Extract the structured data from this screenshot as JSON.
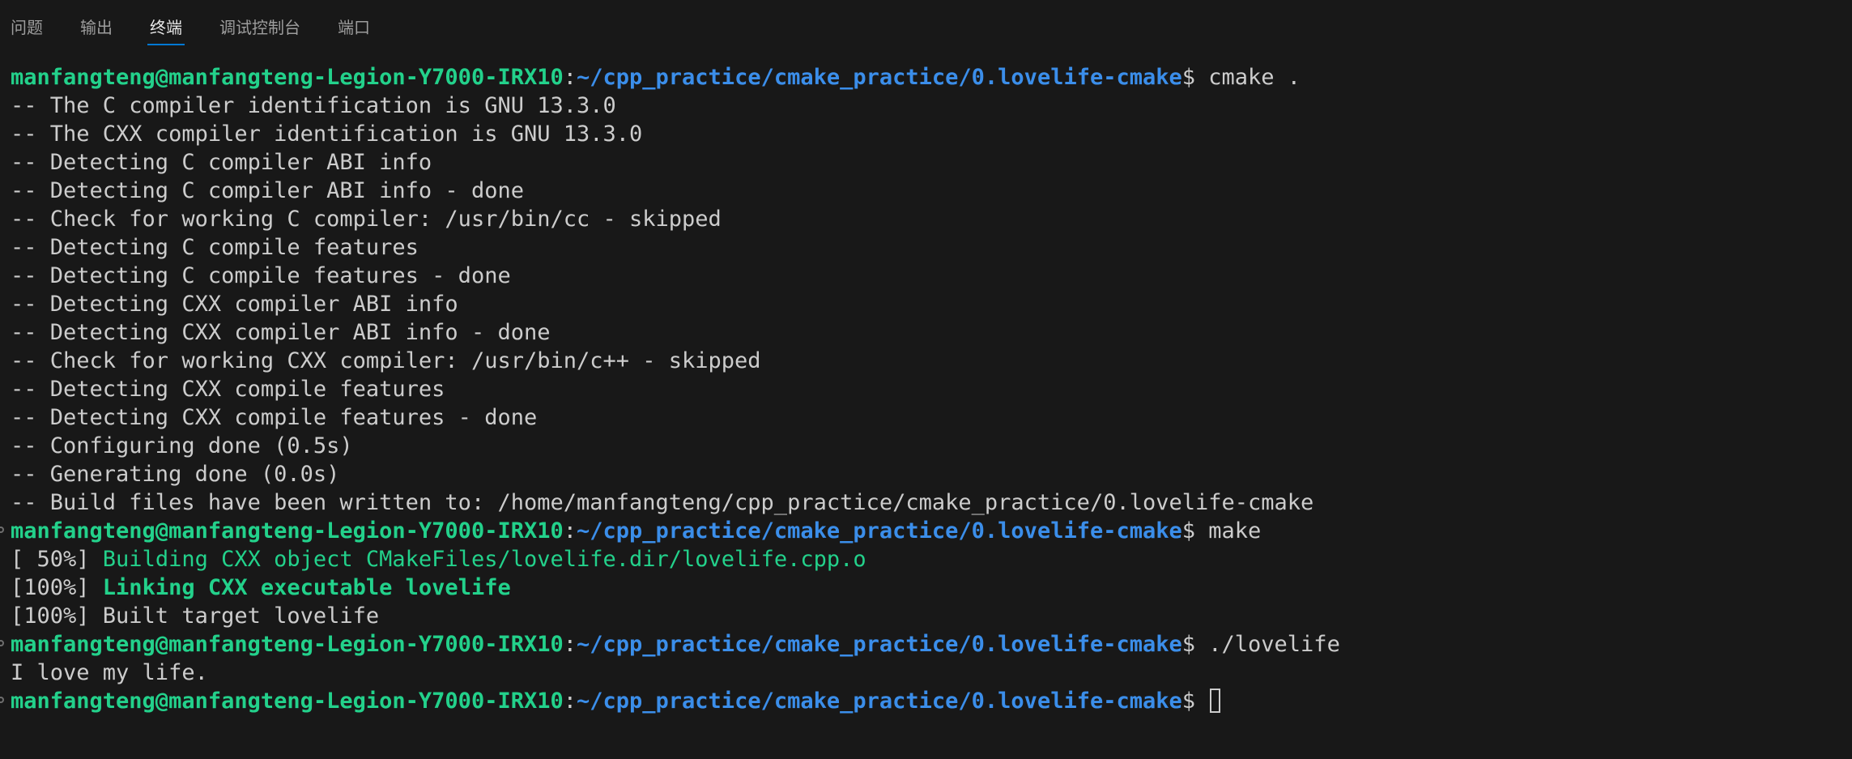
{
  "panel_tabs": [
    {
      "label": "问题",
      "active": false
    },
    {
      "label": "输出",
      "active": false
    },
    {
      "label": "终端",
      "active": true
    },
    {
      "label": "调试控制台",
      "active": false
    },
    {
      "label": "端口",
      "active": false
    }
  ],
  "prompt": {
    "user_host": "manfangteng@manfangteng-Legion-Y7000-IRX10",
    "separator": ":",
    "path": "~/cpp_practice/cmake_practice/0.lovelife-cmake",
    "symbol": "$ "
  },
  "commands": {
    "cmake": "cmake .",
    "make": "make",
    "run": "./lovelife"
  },
  "cmake_output": [
    "-- The C compiler identification is GNU 13.3.0",
    "-- The CXX compiler identification is GNU 13.3.0",
    "-- Detecting C compiler ABI info",
    "-- Detecting C compiler ABI info - done",
    "-- Check for working C compiler: /usr/bin/cc - skipped",
    "-- Detecting C compile features",
    "-- Detecting C compile features - done",
    "-- Detecting CXX compiler ABI info",
    "-- Detecting CXX compiler ABI info - done",
    "-- Check for working CXX compiler: /usr/bin/c++ - skipped",
    "-- Detecting CXX compile features",
    "-- Detecting CXX compile features - done",
    "-- Configuring done (0.5s)",
    "-- Generating done (0.0s)",
    "-- Build files have been written to: /home/manfangteng/cpp_practice/cmake_practice/0.lovelife-cmake"
  ],
  "make_output": {
    "line1_progress": "[ 50%] ",
    "line1_text": "Building CXX object CMakeFiles/lovelife.dir/lovelife.cpp.o",
    "line2_progress": "[100%] ",
    "line2_text": "Linking CXX executable lovelife",
    "line3": "[100%] Built target lovelife"
  },
  "run_output": "I love my life.",
  "colors": {
    "background": "#181818",
    "text": "#cccccc",
    "user_host": "#23d18b",
    "path": "#3b8eea",
    "active_tab_underline": "#0078d4"
  }
}
